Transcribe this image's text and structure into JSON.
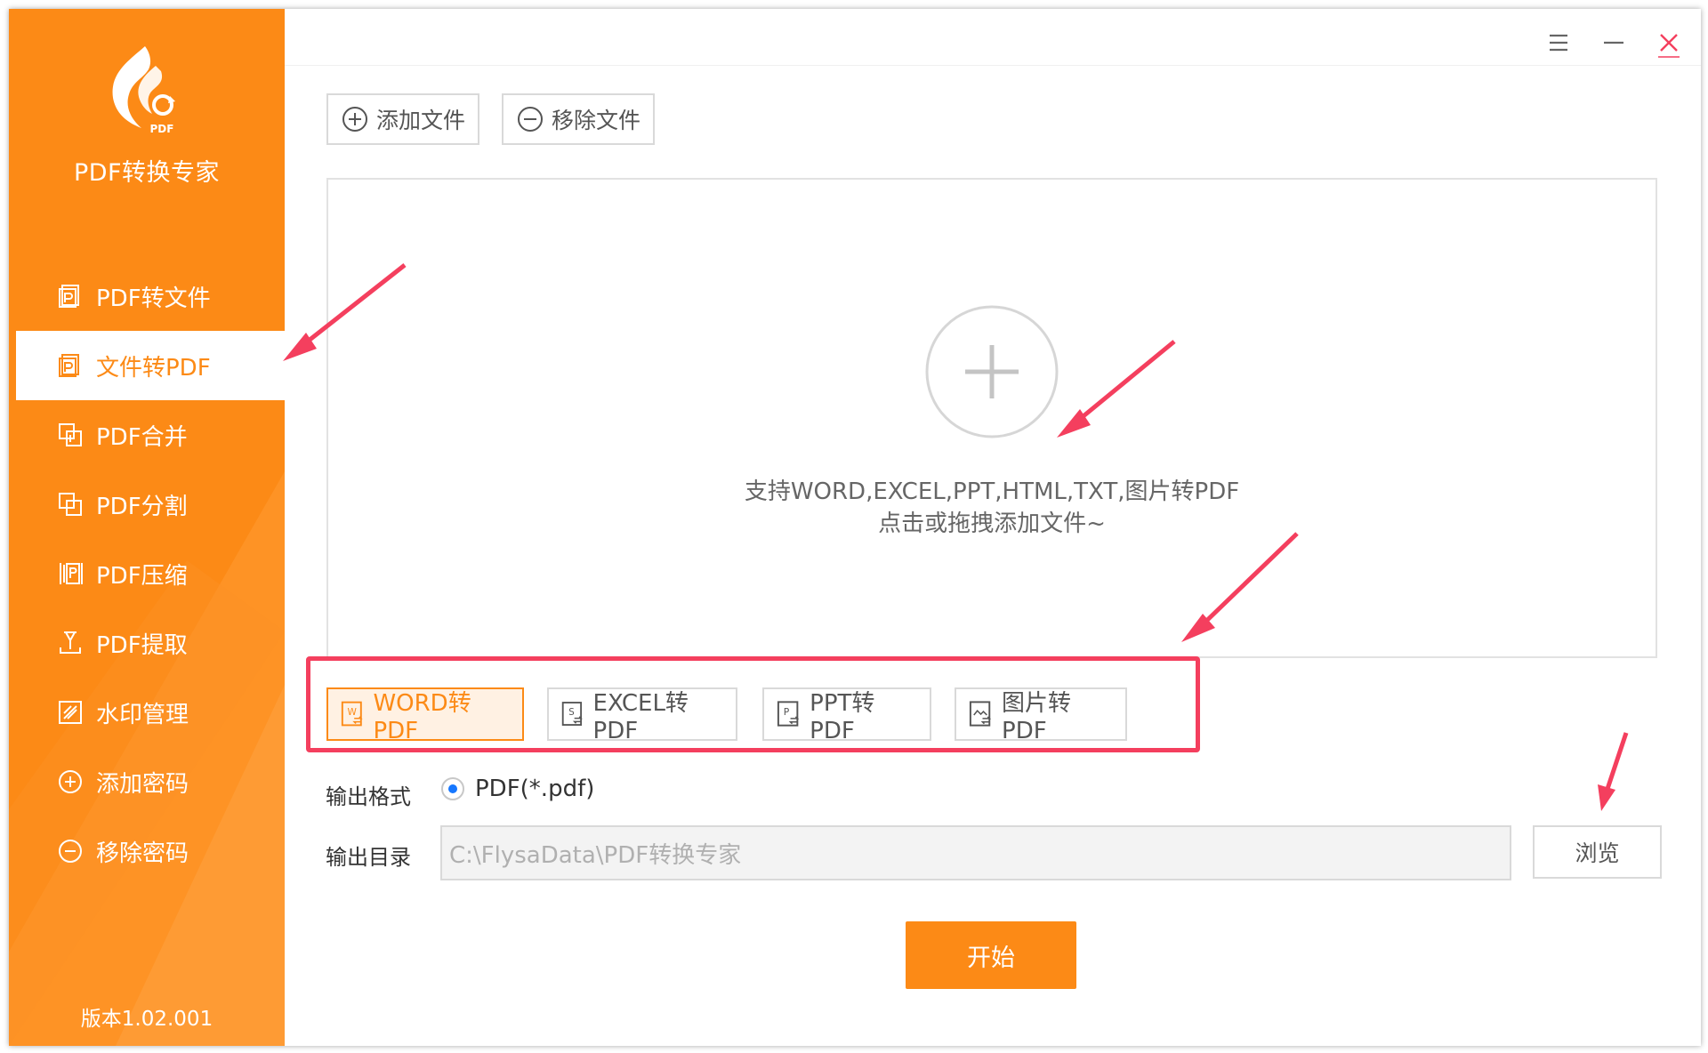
{
  "app": {
    "title": "PDF转换专家",
    "logo_badge": "PDF",
    "version": "版本1.02.001"
  },
  "colors": {
    "brand": "#fc8a16",
    "annotation": "#f43f5e",
    "radio": "#1677ff"
  },
  "sidebar": {
    "items": [
      {
        "label": "PDF转文件",
        "icon": "pdf-file-icon"
      },
      {
        "label": "文件转PDF",
        "icon": "file-to-pdf-icon",
        "active": true
      },
      {
        "label": "PDF合并",
        "icon": "merge-icon"
      },
      {
        "label": "PDF分割",
        "icon": "split-icon"
      },
      {
        "label": "PDF压缩",
        "icon": "compress-icon"
      },
      {
        "label": "PDF提取",
        "icon": "extract-icon"
      },
      {
        "label": "水印管理",
        "icon": "watermark-icon"
      },
      {
        "label": "添加密码",
        "icon": "add-password-icon"
      },
      {
        "label": "移除密码",
        "icon": "remove-password-icon"
      }
    ]
  },
  "toolbar": {
    "add_file": "添加文件",
    "remove_file": "移除文件"
  },
  "dropzone": {
    "line1": "支持WORD,EXCEL,PPT,HTML,TXT,图片转PDF",
    "line2": "点击或拖拽添加文件~"
  },
  "convert_tabs": [
    {
      "label": "WORD转PDF",
      "icon": "word-doc-icon",
      "active": true
    },
    {
      "label": "EXCEL转PDF",
      "icon": "excel-doc-icon"
    },
    {
      "label": "PPT转PDF",
      "icon": "ppt-doc-icon"
    },
    {
      "label": "图片转PDF",
      "icon": "image-doc-icon"
    }
  ],
  "output": {
    "format_label": "输出格式",
    "format_option": "PDF(*.pdf)",
    "dir_label": "输出目录",
    "dir_value": "C:\\FlysaData\\PDF转换专家",
    "browse": "浏览"
  },
  "start_button": "开始"
}
